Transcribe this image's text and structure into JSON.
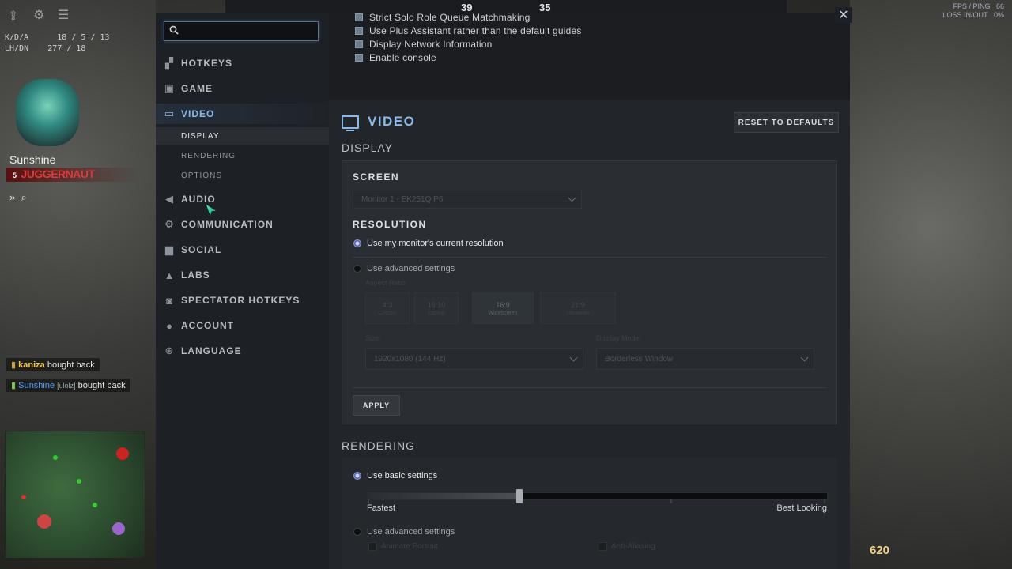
{
  "hud": {
    "kda_label": "K/D/A",
    "kda_value": "18 / 5 / 13",
    "lhdn_label": "LH/DN",
    "lhdn_value": "277 / 18",
    "player_name": "Sunshine",
    "hero_name": "JUGGERNAUT",
    "hero_level": "5",
    "top_score_left": "39",
    "top_score_right": "35",
    "fps_label": "FPS / PING",
    "fps_value": "66",
    "loss_label": "LOSS IN/OUT",
    "loss_value": "0%",
    "gold": "620",
    "killfeed": [
      {
        "name": "kaniza",
        "tag": "",
        "text": "bought back"
      },
      {
        "name": "Sunshine",
        "tag": "[ulolz]",
        "text": "bought back"
      }
    ]
  },
  "sidebar": {
    "search_placeholder": "",
    "items": [
      {
        "label": "HOTKEYS",
        "icon": "grid-icon"
      },
      {
        "label": "GAME",
        "icon": "game-icon"
      },
      {
        "label": "VIDEO",
        "icon": "monitor-icon"
      },
      {
        "label": "AUDIO",
        "icon": "speaker-icon"
      },
      {
        "label": "COMMUNICATION",
        "icon": "gear-icon"
      },
      {
        "label": "SOCIAL",
        "icon": "chat-icon"
      },
      {
        "label": "LABS",
        "icon": "flask-icon"
      },
      {
        "label": "SPECTATOR HOTKEYS",
        "icon": "camera-icon"
      },
      {
        "label": "ACCOUNT",
        "icon": "user-icon"
      },
      {
        "label": "LANGUAGE",
        "icon": "globe-icon"
      }
    ],
    "video_sub": [
      "DISPLAY",
      "RENDERING",
      "OPTIONS"
    ]
  },
  "top_checks": [
    "Strict Solo Role Queue Matchmaking",
    "Use Plus Assistant rather than the default guides",
    "Display Network Information",
    "Enable console"
  ],
  "video": {
    "title": "VIDEO",
    "reset_label": "RESET TO DEFAULTS",
    "display_heading": "DISPLAY",
    "screen_label": "SCREEN",
    "screen_value": "Monitor 1 - EK251Q P6",
    "resolution_label": "RESOLUTION",
    "res_option_monitor": "Use my monitor's current resolution",
    "res_option_advanced": "Use advanced settings",
    "aspect_label": "Aspect Ratio:",
    "aspects": [
      {
        "ratio": "4:3",
        "name": "Classic"
      },
      {
        "ratio": "16:10",
        "name": "Laptop"
      },
      {
        "ratio": "16:9",
        "name": "Widescreen"
      },
      {
        "ratio": "21:9",
        "name": "Ultrawide"
      }
    ],
    "size_label": "Size:",
    "size_value": "1920x1080 (144 Hz)",
    "display_mode_label": "Display Mode:",
    "display_mode_value": "Borderless Window",
    "apply_label": "APPLY",
    "rendering_heading": "RENDERING",
    "render_basic": "Use basic settings",
    "render_advanced": "Use advanced settings",
    "slider_min_label": "Fastest",
    "slider_max_label": "Best Looking",
    "slider_value": 0.33,
    "adv_check_1": "Animate Portrait",
    "adv_check_2": "Anti-Aliasing"
  }
}
